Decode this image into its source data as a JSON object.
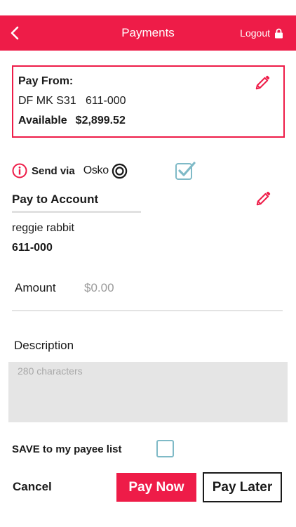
{
  "header": {
    "title": "Payments",
    "back_icon": "chevron-left-icon",
    "logout_label": "Logout",
    "logout_icon": "lock-icon",
    "bg_color": "#ee1c48"
  },
  "pay_from": {
    "label": "Pay From:",
    "account_name": "DF MK S31",
    "bsb": "611-000",
    "available_label": "Available",
    "available_amount": "$2,899.52",
    "edit_icon": "pencil-icon"
  },
  "send_via": {
    "info_icon": "info-circle-icon",
    "label": "Send via",
    "network": "Osko",
    "network_icon": "osko-logo-icon",
    "checked": true
  },
  "pay_to": {
    "label": "Pay to Account",
    "edit_icon": "pencil-icon",
    "payee_name": "reggie rabbit",
    "payee_bsb": "611-000"
  },
  "amount": {
    "label": "Amount",
    "value": "",
    "placeholder": "$0.00"
  },
  "description": {
    "label": "Description",
    "value": "",
    "placeholder": "280 characters"
  },
  "save_payee": {
    "label": "SAVE to my payee list",
    "checked": false
  },
  "actions": {
    "cancel_label": "Cancel",
    "pay_now_label": "Pay Now",
    "pay_later_label": "Pay Later"
  },
  "colors": {
    "accent": "#ee1c48",
    "checkbox": "#7fbac7",
    "field_bg": "#e5e5e5"
  }
}
